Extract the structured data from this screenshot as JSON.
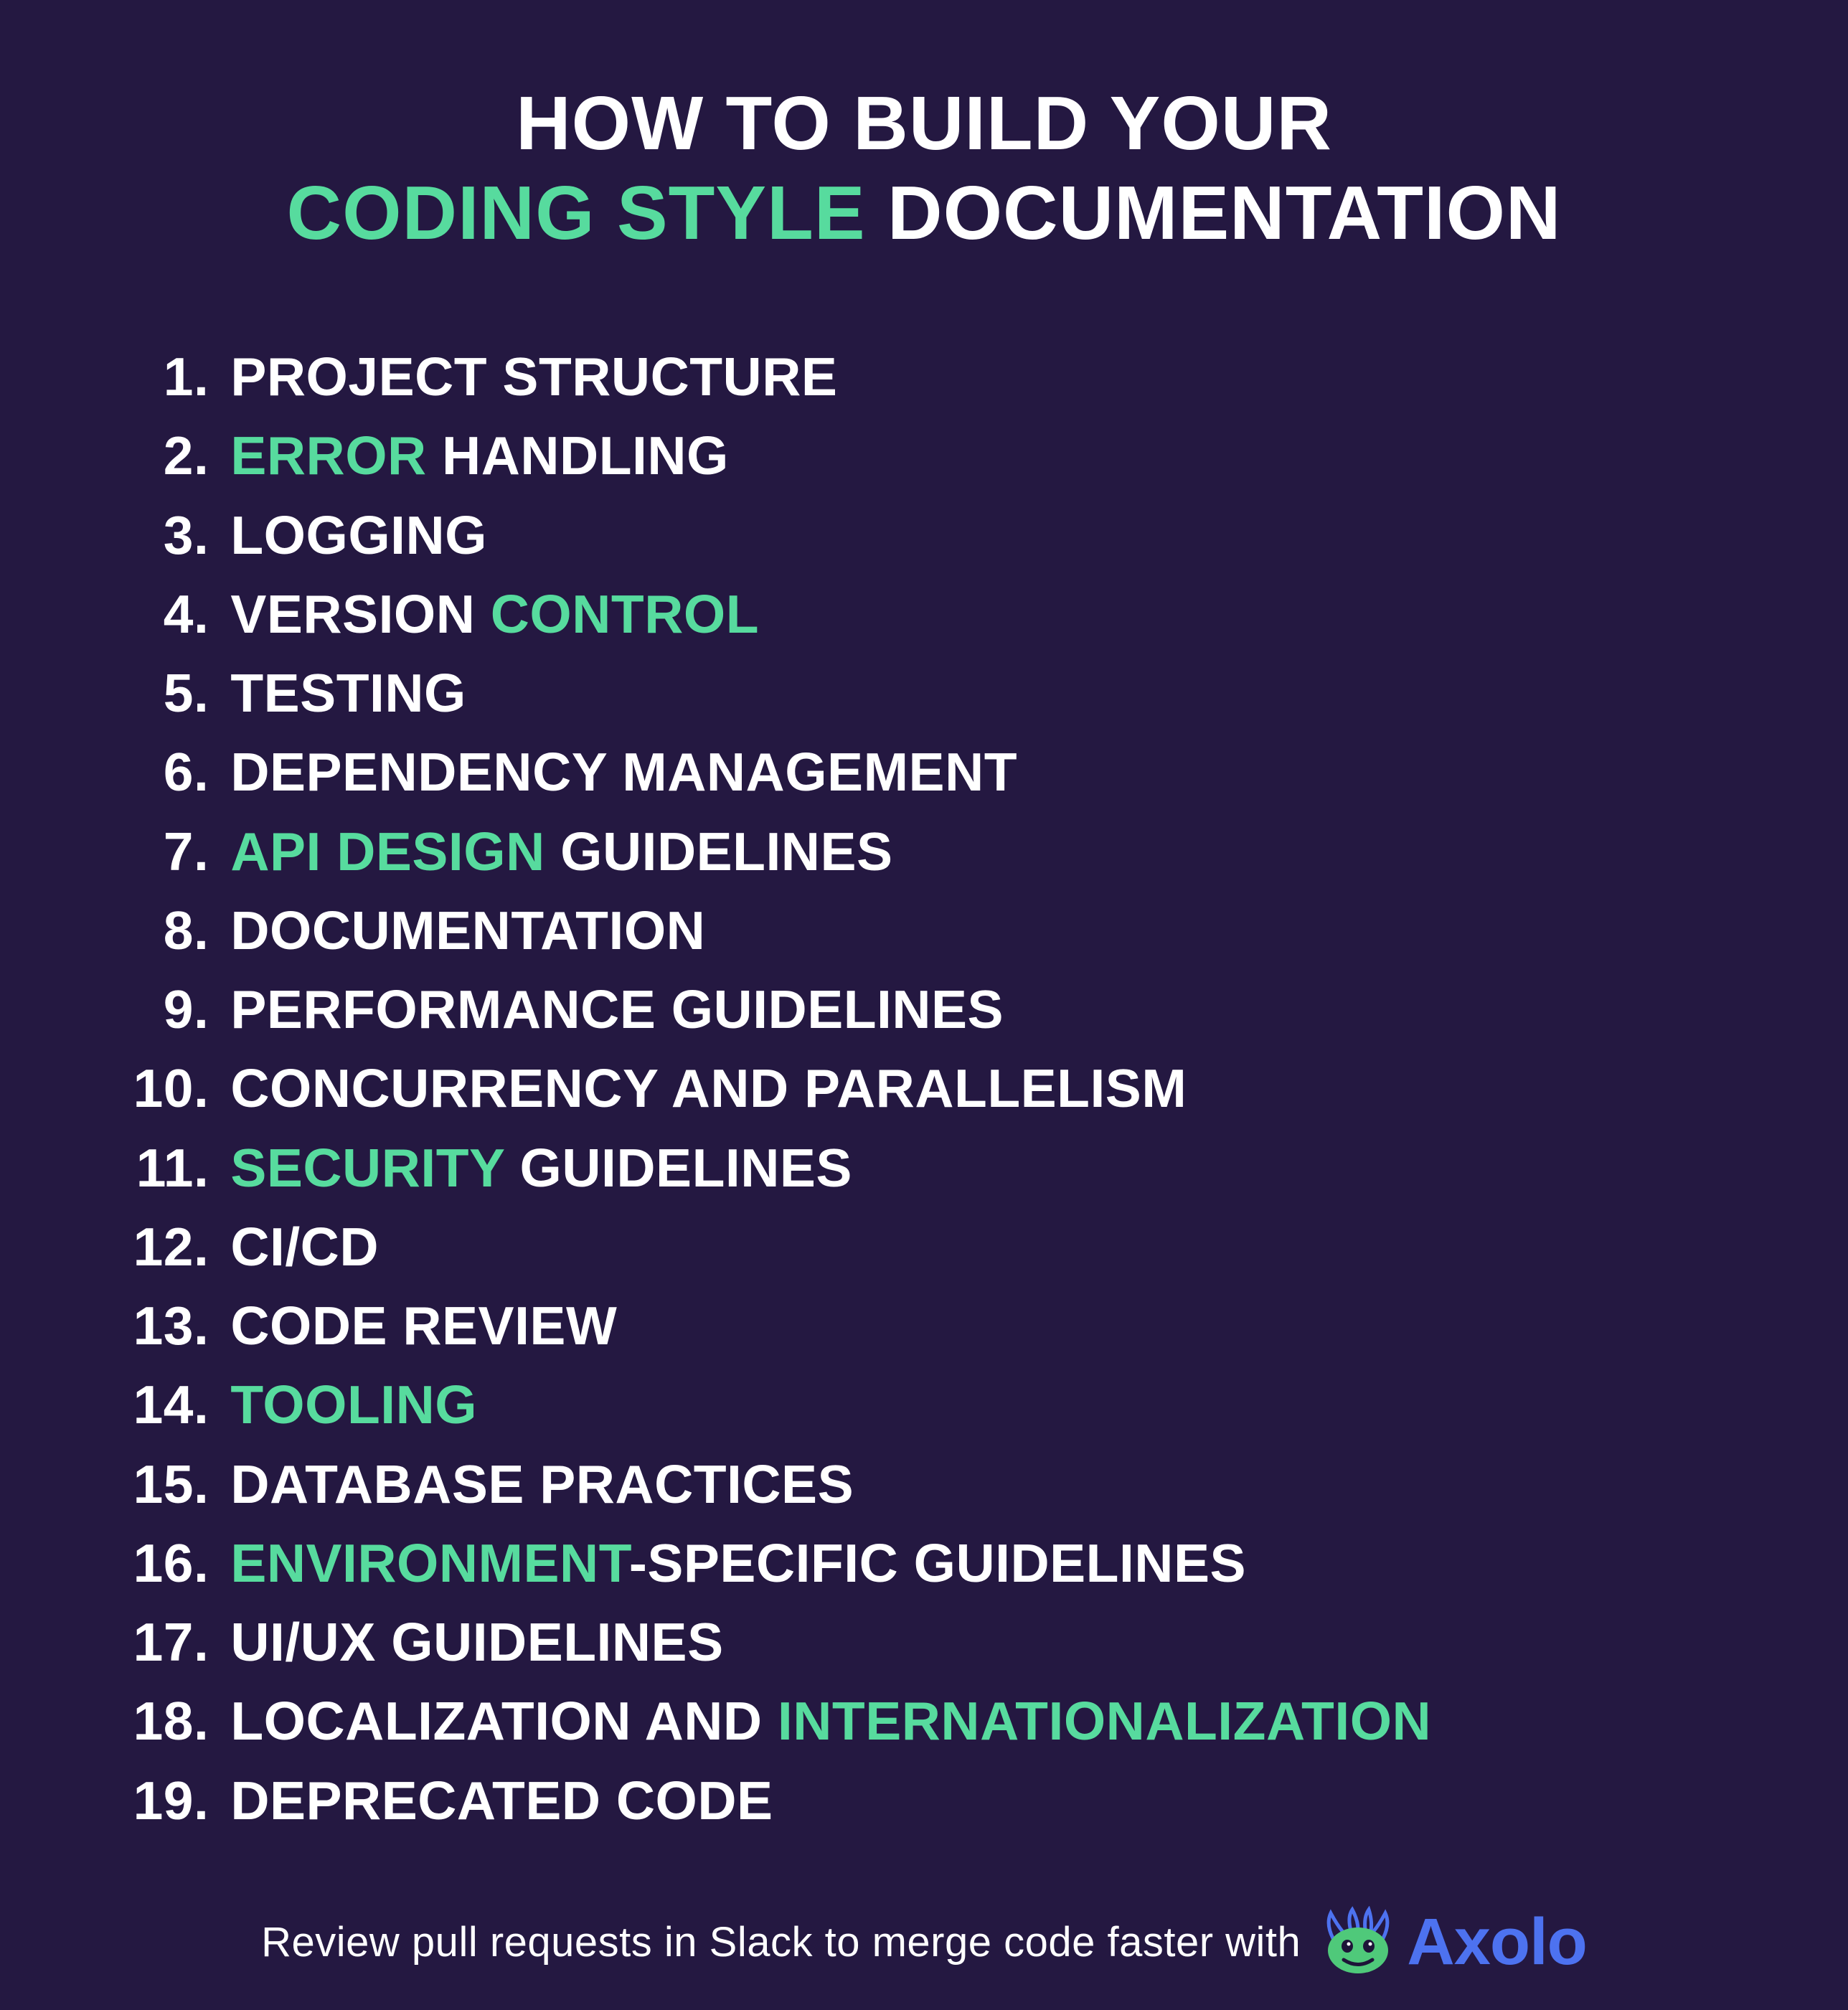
{
  "title": {
    "line1": "HOW TO BUILD YOUR",
    "line2_accent": "CODING STYLE",
    "line2_rest": " DOCUMENTATION"
  },
  "items": [
    {
      "num": "1",
      "parts": [
        {
          "t": "PROJECT STRUCTURE",
          "a": false
        }
      ]
    },
    {
      "num": "2",
      "parts": [
        {
          "t": "ERROR",
          "a": true
        },
        {
          "t": " HANDLING",
          "a": false
        }
      ]
    },
    {
      "num": "3",
      "parts": [
        {
          "t": "LOGGING",
          "a": false
        }
      ]
    },
    {
      "num": "4",
      "parts": [
        {
          "t": "VERSION ",
          "a": false
        },
        {
          "t": "CONTROL",
          "a": true
        }
      ]
    },
    {
      "num": "5",
      "parts": [
        {
          "t": "TESTING",
          "a": false
        }
      ]
    },
    {
      "num": "6",
      "parts": [
        {
          "t": "DEPENDENCY MANAGEMENT",
          "a": false
        }
      ]
    },
    {
      "num": "7",
      "parts": [
        {
          "t": "API DESIGN",
          "a": true
        },
        {
          "t": " GUIDELINES",
          "a": false
        }
      ]
    },
    {
      "num": "8",
      "parts": [
        {
          "t": "DOCUMENTATION",
          "a": false
        }
      ]
    },
    {
      "num": "9",
      "parts": [
        {
          "t": "PERFORMANCE GUIDELINES",
          "a": false
        }
      ]
    },
    {
      "num": "10",
      "parts": [
        {
          "t": "CONCURRENCY AND PARALLELISM",
          "a": false
        }
      ]
    },
    {
      "num": "11",
      "parts": [
        {
          "t": "SECURITY",
          "a": true
        },
        {
          "t": " GUIDELINES",
          "a": false
        }
      ]
    },
    {
      "num": "12",
      "parts": [
        {
          "t": "CI/CD",
          "a": false
        }
      ]
    },
    {
      "num": "13",
      "parts": [
        {
          "t": "CODE REVIEW",
          "a": false
        }
      ]
    },
    {
      "num": "14",
      "parts": [
        {
          "t": "TOOLING",
          "a": true
        }
      ]
    },
    {
      "num": "15",
      "parts": [
        {
          "t": "DATABASE PRACTICES",
          "a": false
        }
      ]
    },
    {
      "num": "16",
      "parts": [
        {
          "t": "ENVIRONMENT",
          "a": true
        },
        {
          "t": "-SPECIFIC GUIDELINES",
          "a": false
        }
      ]
    },
    {
      "num": "17",
      "parts": [
        {
          "t": "UI/UX GUIDELINES",
          "a": false
        }
      ]
    },
    {
      "num": "18",
      "parts": [
        {
          "t": "LOCALIZATION AND ",
          "a": false
        },
        {
          "t": "INTERNATIONALIZATION",
          "a": true
        }
      ]
    },
    {
      "num": "19",
      "parts": [
        {
          "t": "DEPRECATED CODE",
          "a": false
        }
      ]
    }
  ],
  "footer": {
    "text": "Review pull requests in Slack to merge code faster with",
    "brand": "Axolo"
  },
  "colors": {
    "background": "#241841",
    "text": "#ffffff",
    "accent": "#57db9e",
    "brand": "#4d72f0"
  }
}
